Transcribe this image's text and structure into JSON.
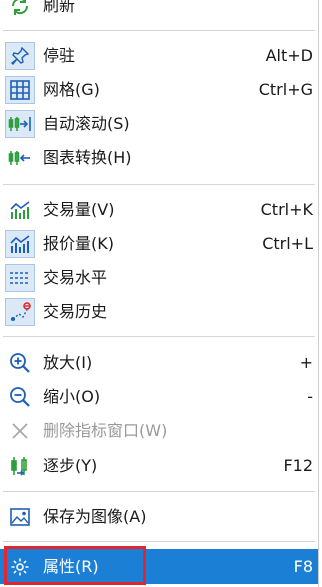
{
  "menu": {
    "items": [
      {
        "label": "刷新",
        "shortcut": ""
      },
      {
        "label": "停驻",
        "shortcut": "Alt+D"
      },
      {
        "label": "网格(G)",
        "shortcut": "Ctrl+G"
      },
      {
        "label": "自动滚动(S)",
        "shortcut": ""
      },
      {
        "label": "图表转换(H)",
        "shortcut": ""
      },
      {
        "label": "交易量(V)",
        "shortcut": "Ctrl+K"
      },
      {
        "label": "报价量(K)",
        "shortcut": "Ctrl+L"
      },
      {
        "label": "交易水平",
        "shortcut": ""
      },
      {
        "label": "交易历史",
        "shortcut": ""
      },
      {
        "label": "放大(I)",
        "shortcut": "+"
      },
      {
        "label": "缩小(O)",
        "shortcut": "-"
      },
      {
        "label": "删除指标窗口(W)",
        "shortcut": ""
      },
      {
        "label": "逐步(Y)",
        "shortcut": "F12"
      },
      {
        "label": "保存为图像(A)",
        "shortcut": ""
      },
      {
        "label": "属性(R)",
        "shortcut": "F8"
      }
    ]
  },
  "colors": {
    "selected_bg": "#1c7fd6",
    "highlight_border": "#e3262e",
    "icon_blue": "#1d5fb8",
    "icon_green": "#2e9e3c"
  }
}
